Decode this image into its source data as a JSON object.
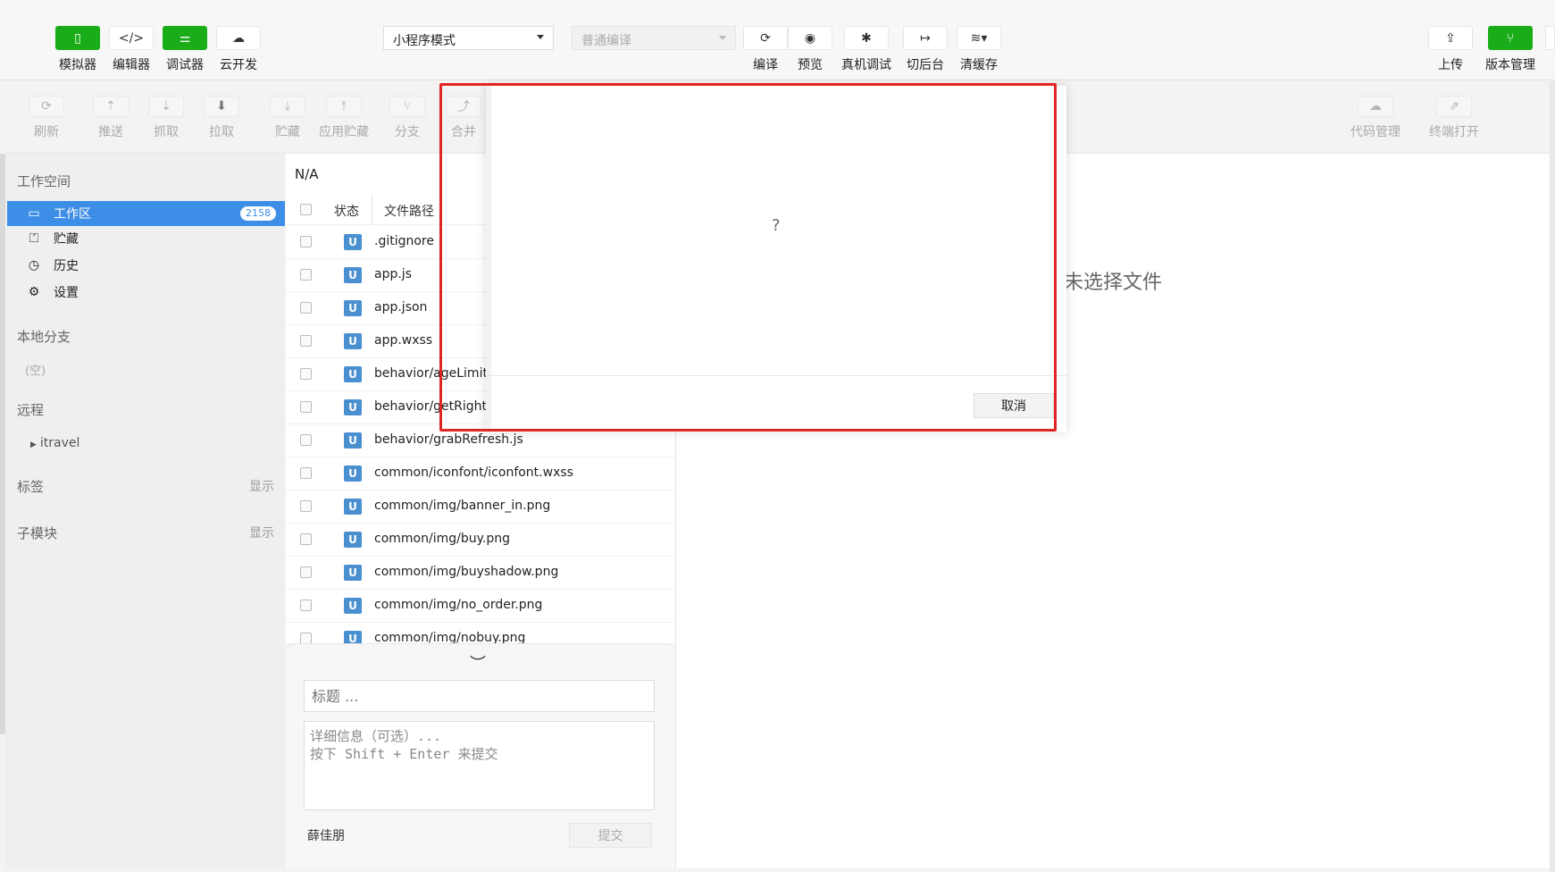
{
  "topbar": {
    "left_buttons": [
      {
        "label": "模拟器",
        "icon": "phone-icon"
      },
      {
        "label": "编辑器",
        "icon": "code-icon"
      },
      {
        "label": "调试器",
        "icon": "sliders-icon"
      },
      {
        "label": "云开发",
        "icon": "cloud-icon"
      }
    ],
    "mode_select": "小程序模式",
    "compile_select": "普通编译",
    "mid_buttons": [
      {
        "label": "编译",
        "icon": "refresh-icon"
      },
      {
        "label": "预览",
        "icon": "eye-icon"
      },
      {
        "label": "真机调试",
        "icon": "bug-icon"
      },
      {
        "label": "切后台",
        "icon": "switch-icon"
      },
      {
        "label": "清缓存",
        "icon": "layers-icon"
      }
    ],
    "right_buttons": [
      {
        "label": "上传",
        "icon": "upload-icon"
      },
      {
        "label": "版本管理",
        "icon": "branch-icon"
      }
    ]
  },
  "git_toolbar": {
    "buttons": [
      {
        "label": "刷新",
        "icon": "refresh-icon"
      },
      {
        "label": "推送",
        "icon": "push-icon"
      },
      {
        "label": "抓取",
        "icon": "fetch-icon"
      },
      {
        "label": "拉取",
        "icon": "pull-icon"
      },
      {
        "label": "贮藏",
        "icon": "stash-icon"
      },
      {
        "label": "应用贮藏",
        "icon": "apply-stash-icon"
      },
      {
        "label": "分支",
        "icon": "branch-icon"
      },
      {
        "label": "合并",
        "icon": "merge-icon"
      },
      {
        "label": "代码管理",
        "icon": "cloud-code-icon"
      },
      {
        "label": "终端打开",
        "icon": "external-icon"
      }
    ]
  },
  "sidebar": {
    "workspace_title": "工作空间",
    "items": [
      {
        "label": "工作区",
        "icon": "folder-icon",
        "badge": "2158"
      },
      {
        "label": "贮藏",
        "icon": "stash-icon"
      },
      {
        "label": "历史",
        "icon": "history-icon"
      },
      {
        "label": "设置",
        "icon": "gear-icon"
      }
    ],
    "local_branch_title": "本地分支",
    "local_branch_empty": "(空)",
    "remote_title": "远程",
    "remote_item": "itravel",
    "tags_title": "标签",
    "tags_show": "显示",
    "submodule_title": "子模块",
    "submodule_show": "显示"
  },
  "filelist": {
    "header": "N/A",
    "col_status": "状态",
    "col_path": "文件路径",
    "status_letter": "U",
    "files": [
      ".gitignore",
      "app.js",
      "app.json",
      "app.wxss",
      "behavior/ageLimit.j",
      "behavior/getRights",
      "behavior/grabRefresh.js",
      "common/iconfont/iconfont.wxss",
      "common/img/banner_in.png",
      "common/img/buy.png",
      "common/img/buyshadow.png",
      "common/img/no_order.png",
      "common/img/nobuy.png"
    ]
  },
  "commit": {
    "title_placeholder": "标题 ...",
    "detail_placeholder": "详细信息（可选）...\n按下 Shift + Enter 来提交",
    "author": "薛佳朋",
    "submit": "提交"
  },
  "content": {
    "no_file": "未选择文件"
  },
  "dialog": {
    "message": "?",
    "cancel": "取消"
  },
  "colors": {
    "accent_green": "#1aad19",
    "active_blue": "#3d8ee6",
    "highlight_red": "#e02525"
  }
}
